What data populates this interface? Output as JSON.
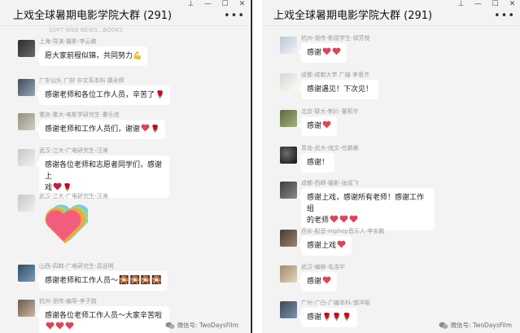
{
  "left_window": {
    "title": "上戏全球暑期电影学院大群 (291)",
    "controls": [
      "pin",
      "minimize",
      "maximize",
      "close"
    ],
    "more_label": "•••",
    "faded_header": "SOFT WEB NEWS...BOOKS",
    "messages": [
      {
        "name": "上海-导演-摄影-李云鹏",
        "text": "愿大家前程似锦，共同努力",
        "emoji": [
          "strong-arm"
        ]
      },
      {
        "name": "广东汕头 广财 中文系本科 康永辉",
        "text": "感谢老师和各位工作人员，辛苦了",
        "emoji": [
          "rose"
        ]
      },
      {
        "name": "重庆-重大-电影学研究生-曹乐佳",
        "text": "感谢老师和工作人员们，谢谢",
        "emoji": [
          "heart",
          "rose"
        ]
      },
      {
        "name": "武汉-江大-广电研究生-汪涛",
        "text_line1": "感谢各位老师和志愿者同学们，感谢上",
        "text_line2": "戏",
        "emoji": [
          "heart",
          "rose"
        ]
      },
      {
        "name": "武汉-江大-广电研究生-汪涛",
        "sticker": "heart-sticker"
      },
      {
        "name": "山西-四韩-广电研究生-袁远明",
        "text": "感谢老师和工作人员～",
        "emoji": [
          "firework",
          "firework",
          "firework",
          "firework"
        ]
      },
      {
        "name": "杭州-浙传-编导-李子勋",
        "text_line1": "感谢各位老师工作人员～大家辛苦啦",
        "emoji": [
          "heart",
          "heart",
          "heart"
        ]
      }
    ],
    "watermark": "微信号: TwoDaysFilm"
  },
  "right_window": {
    "title": "上戏全球暑期电影学院大群 (291)",
    "controls": [
      "pin",
      "minimize",
      "maximize",
      "close"
    ],
    "more_label": "•••",
    "messages": [
      {
        "name": "杭州-浙传-影视学生-邬芳悦",
        "text": "感谢",
        "emoji": [
          "heart",
          "heart"
        ]
      },
      {
        "name": "成都-成都大学 广编 李思齐",
        "text": "感谢遇见！下次见！"
      },
      {
        "name": "北京-联大-制片-董熙宇",
        "text": "感谢",
        "emoji": [
          "heart"
        ]
      },
      {
        "name": "青岛-武大-戏文-任鹏晨",
        "text": "感谢！"
      },
      {
        "name": "成都-西師-摄影-张成飞",
        "text_line1": "感谢上戏，感谢所有老师！感谢工作组",
        "text_line2": "的老师",
        "emoji": [
          "heart",
          "heart",
          "heart"
        ]
      },
      {
        "name": "西安-配音-Hiphop音乐人-李安鹏",
        "text": "感谢上戏",
        "emoji": [
          "heart"
        ]
      },
      {
        "name": "武汉-编剧-毛浩宇",
        "text": "感谢",
        "emoji": [
          "heart"
        ]
      },
      {
        "name": "广州-广白-广编本科-邹洋韬",
        "text": "感谢",
        "emoji": [
          "rose",
          "rose",
          "rose"
        ]
      }
    ],
    "watermark": "微信号: TwoDaysFilm"
  },
  "colors": {
    "window_bg": "#f3f3f3",
    "bubble_bg": "#ffffff",
    "heart": "#e0445a",
    "rose": "#c0332b",
    "divider": "#2b2b2b"
  }
}
